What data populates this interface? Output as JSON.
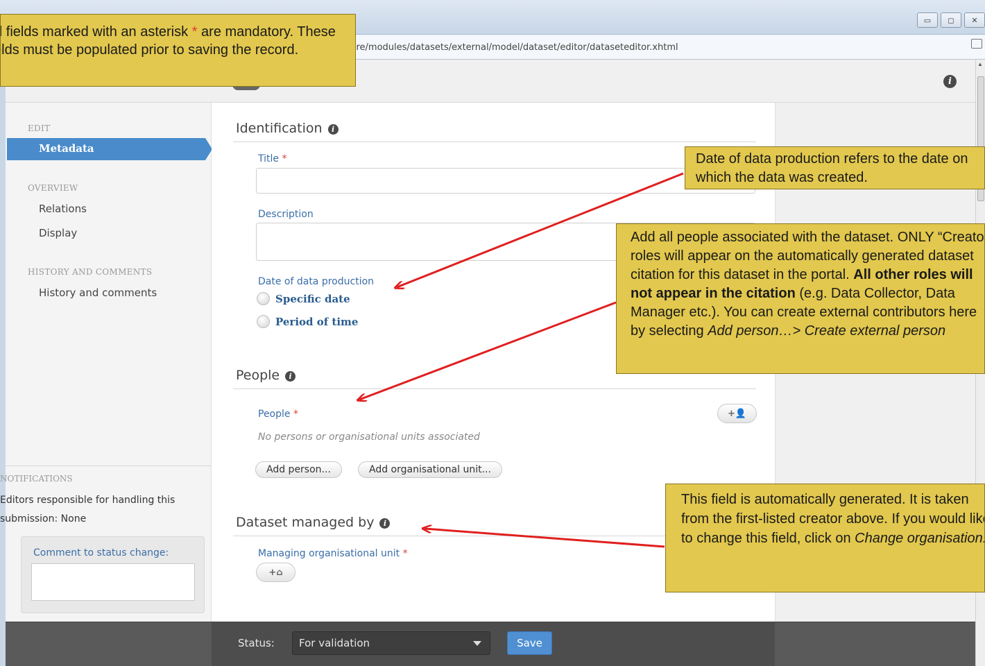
{
  "browser": {
    "url": "pure/modules/datasets/external/model/dataset/editor/dataseteditor.xhtml",
    "minimize_glyph": "▭",
    "maximize_glyph": "◻",
    "close_glyph": "✕"
  },
  "nav": {
    "edit_section": "EDIT",
    "metadata": "Metadata",
    "overview_section": "OVERVIEW",
    "relations": "Relations",
    "display": "Display",
    "history_section": "HISTORY AND COMMENTS",
    "history_item": "History and comments"
  },
  "notifications": {
    "label": "NOTIFICATIONS",
    "text": "Editors responsible for handling this submission: None",
    "comment_label": "Comment to status change:"
  },
  "identification": {
    "title": "Identification",
    "title_field_label": "Title",
    "description_label": "Description",
    "date_label": "Date of data production",
    "specific_date": "Specific date",
    "period_of_time": "Period of time"
  },
  "people": {
    "title": "People",
    "field_label": "People",
    "empty_text": "No persons or organisational units associated",
    "add_person": "Add person...",
    "add_org_unit": "Add organisational unit...",
    "add_icon_glyph": "+👤"
  },
  "managed": {
    "title": "Dataset managed by",
    "field_label": "Managing organisational unit",
    "add_icon_glyph": "+⌂"
  },
  "asterisk": "*",
  "status_bar": {
    "label": "Status:",
    "value": "For validation",
    "save": "Save"
  },
  "callouts": {
    "mandatory_pre": "All fields marked with an asterisk",
    "mandatory_post": "are mandatory. These fields must be populated prior to saving the record.",
    "date_text": "Date of data production refers to the date on which the data was created.",
    "people_p1": "Add all people associated with the dataset. ONLY “Creator” roles will appear on the automatically generated dataset citation for this dataset in the portal.",
    "people_bold": "All other roles will not appear in the citation",
    "people_p2": "(e.g. Data Collector, Data Manager etc.). You can create external contributors here by selecting",
    "people_italic": "Add person…> Create external person",
    "managed_text": "This field is automatically generated. It is taken from the first-listed creator above. If you would like to change this field, click on",
    "managed_italic": "Change organisation."
  },
  "colors": {
    "accent": "#4a8ccb",
    "callout": "#e2c84e",
    "arrow": "#e01f1f",
    "asterisk": "#d9443c",
    "status_bar": "#4d4d4d"
  },
  "icons": [
    "info-icon",
    "add-person-icon",
    "add-organisation-icon",
    "dropdown-arrow-icon",
    "minimize-icon",
    "maximize-icon",
    "close-icon"
  ]
}
